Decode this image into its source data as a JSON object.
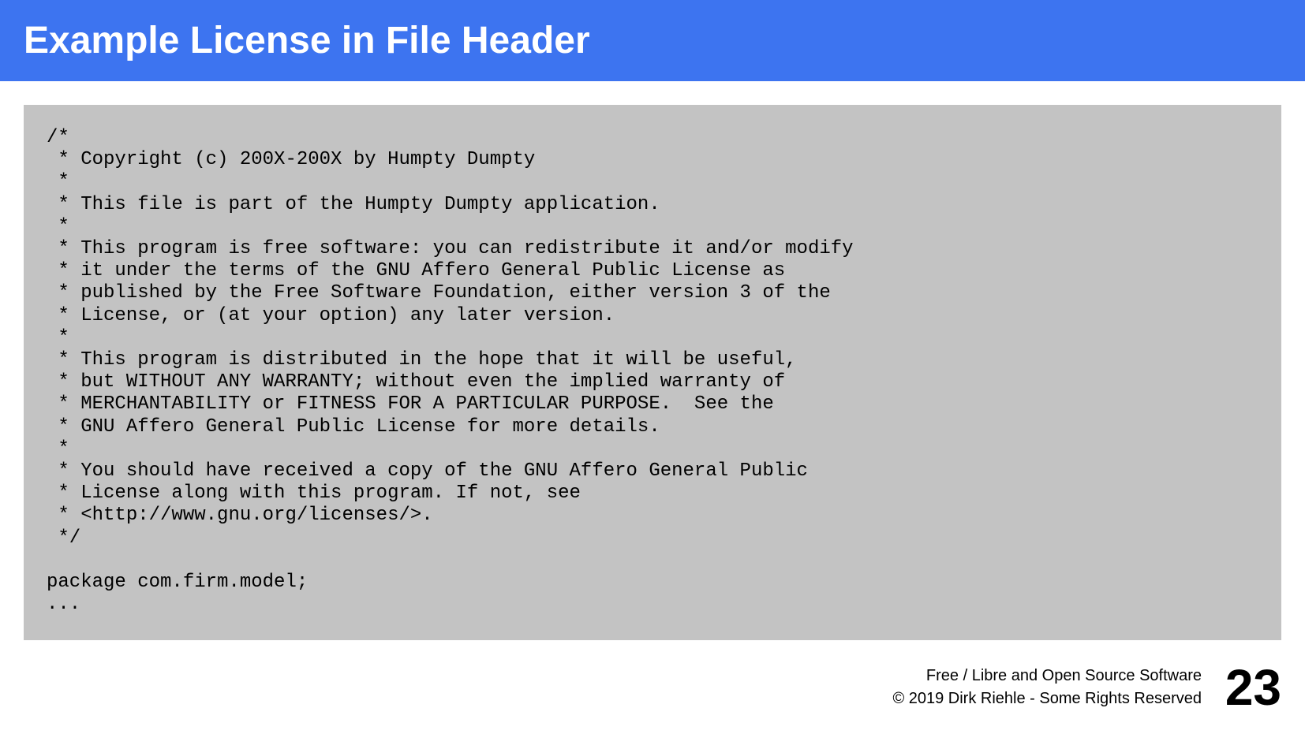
{
  "slide": {
    "title": "Example License in File Header",
    "code_lines": [
      "/*",
      " * Copyright (c) 200X-200X by Humpty Dumpty",
      " *",
      " * This file is part of the Humpty Dumpty application.",
      " *",
      " * This program is free software: you can redistribute it and/or modify",
      " * it under the terms of the GNU Affero General Public License as",
      " * published by the Free Software Foundation, either version 3 of the",
      " * License, or (at your option) any later version.",
      " *",
      " * This program is distributed in the hope that it will be useful,",
      " * but WITHOUT ANY WARRANTY; without even the implied warranty of",
      " * MERCHANTABILITY or FITNESS FOR A PARTICULAR PURPOSE.  See the",
      " * GNU Affero General Public License for more details.",
      " *",
      " * You should have received a copy of the GNU Affero General Public",
      " * License along with this program. If not, see",
      " * <http://www.gnu.org/licenses/>.",
      " */",
      "",
      "package com.firm.model;",
      "..."
    ],
    "footer": {
      "line1": "Free / Libre and Open Source Software",
      "line2": "© 2019 Dirk Riehle - Some Rights Reserved"
    },
    "page_number": "23"
  },
  "colors": {
    "title_bar": "#3d74f0",
    "code_background": "#c3c3c3"
  }
}
